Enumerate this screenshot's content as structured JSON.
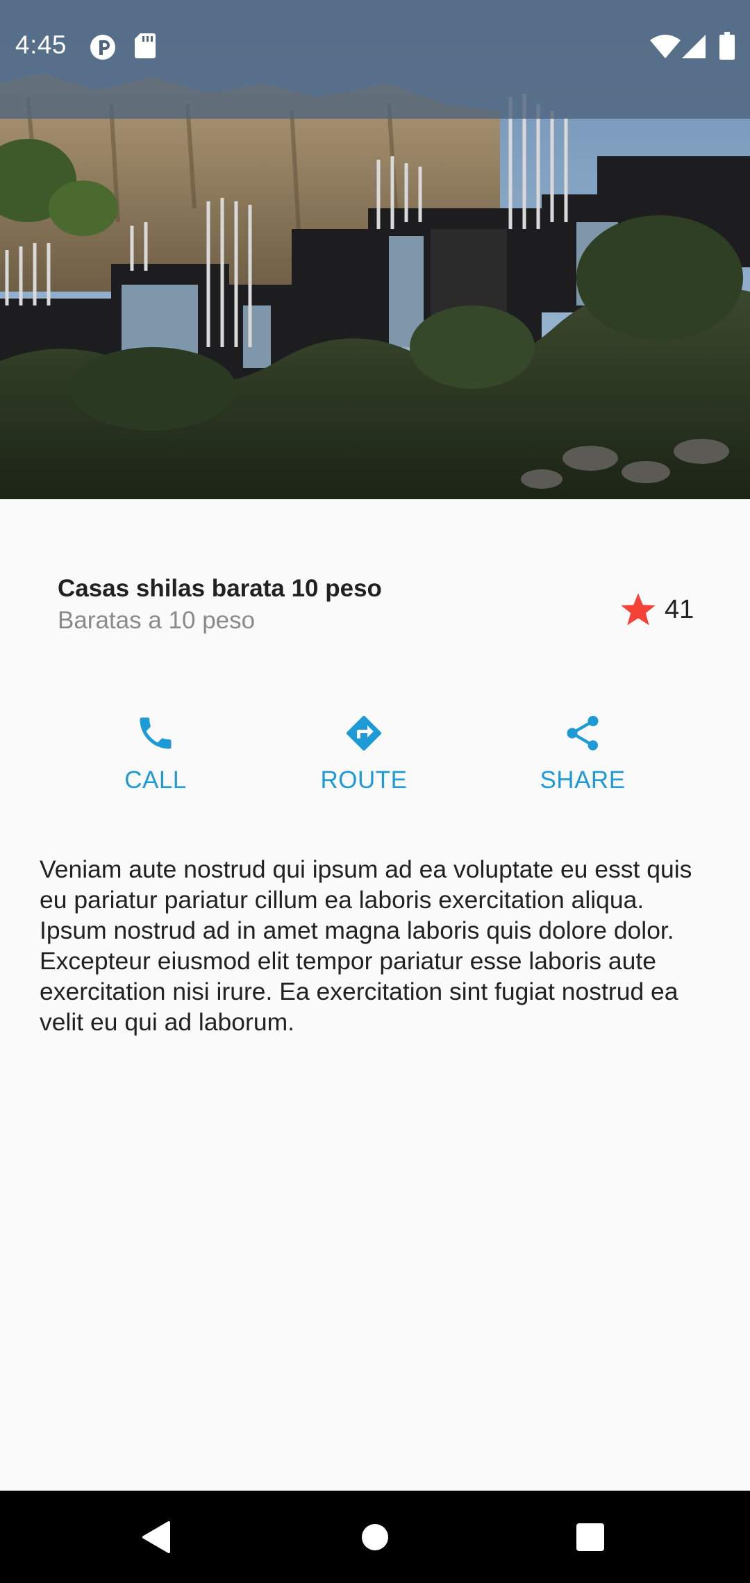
{
  "status_bar": {
    "time": "4:45",
    "left_icons": [
      "notification-p-icon",
      "sd-card-icon"
    ],
    "right_icons": [
      "wifi-icon",
      "cellular-signal-icon",
      "battery-icon"
    ]
  },
  "hero": {
    "image_name": "modern-cliffside-houses-photo"
  },
  "place": {
    "title": "Casas shilas barata 10 peso",
    "subtitle": "Baratas a 10 peso",
    "rating_icon": "star-icon",
    "rating_count": "41",
    "rating_color": "#f44336"
  },
  "actions": [
    {
      "label": "CALL",
      "icon": "phone-icon"
    },
    {
      "label": "ROUTE",
      "icon": "directions-icon"
    },
    {
      "label": "SHARE",
      "icon": "share-icon"
    }
  ],
  "accent_color": "#1e9bd7",
  "description": "Veniam aute nostrud qui ipsum ad ea voluptate eu esst quis eu pariatur pariatur cillum ea laboris exercitation aliqua. Ipsum nostrud ad in amet magna laboris quis dolore dolor. Excepteur eiusmod elit tempor pariatur esse laboris aute exercitation nisi irure. Ea exercitation sint fugiat nostrud ea velit eu qui ad laborum.",
  "nav_bar": {
    "buttons": [
      "back-icon",
      "home-icon",
      "recents-icon"
    ]
  }
}
